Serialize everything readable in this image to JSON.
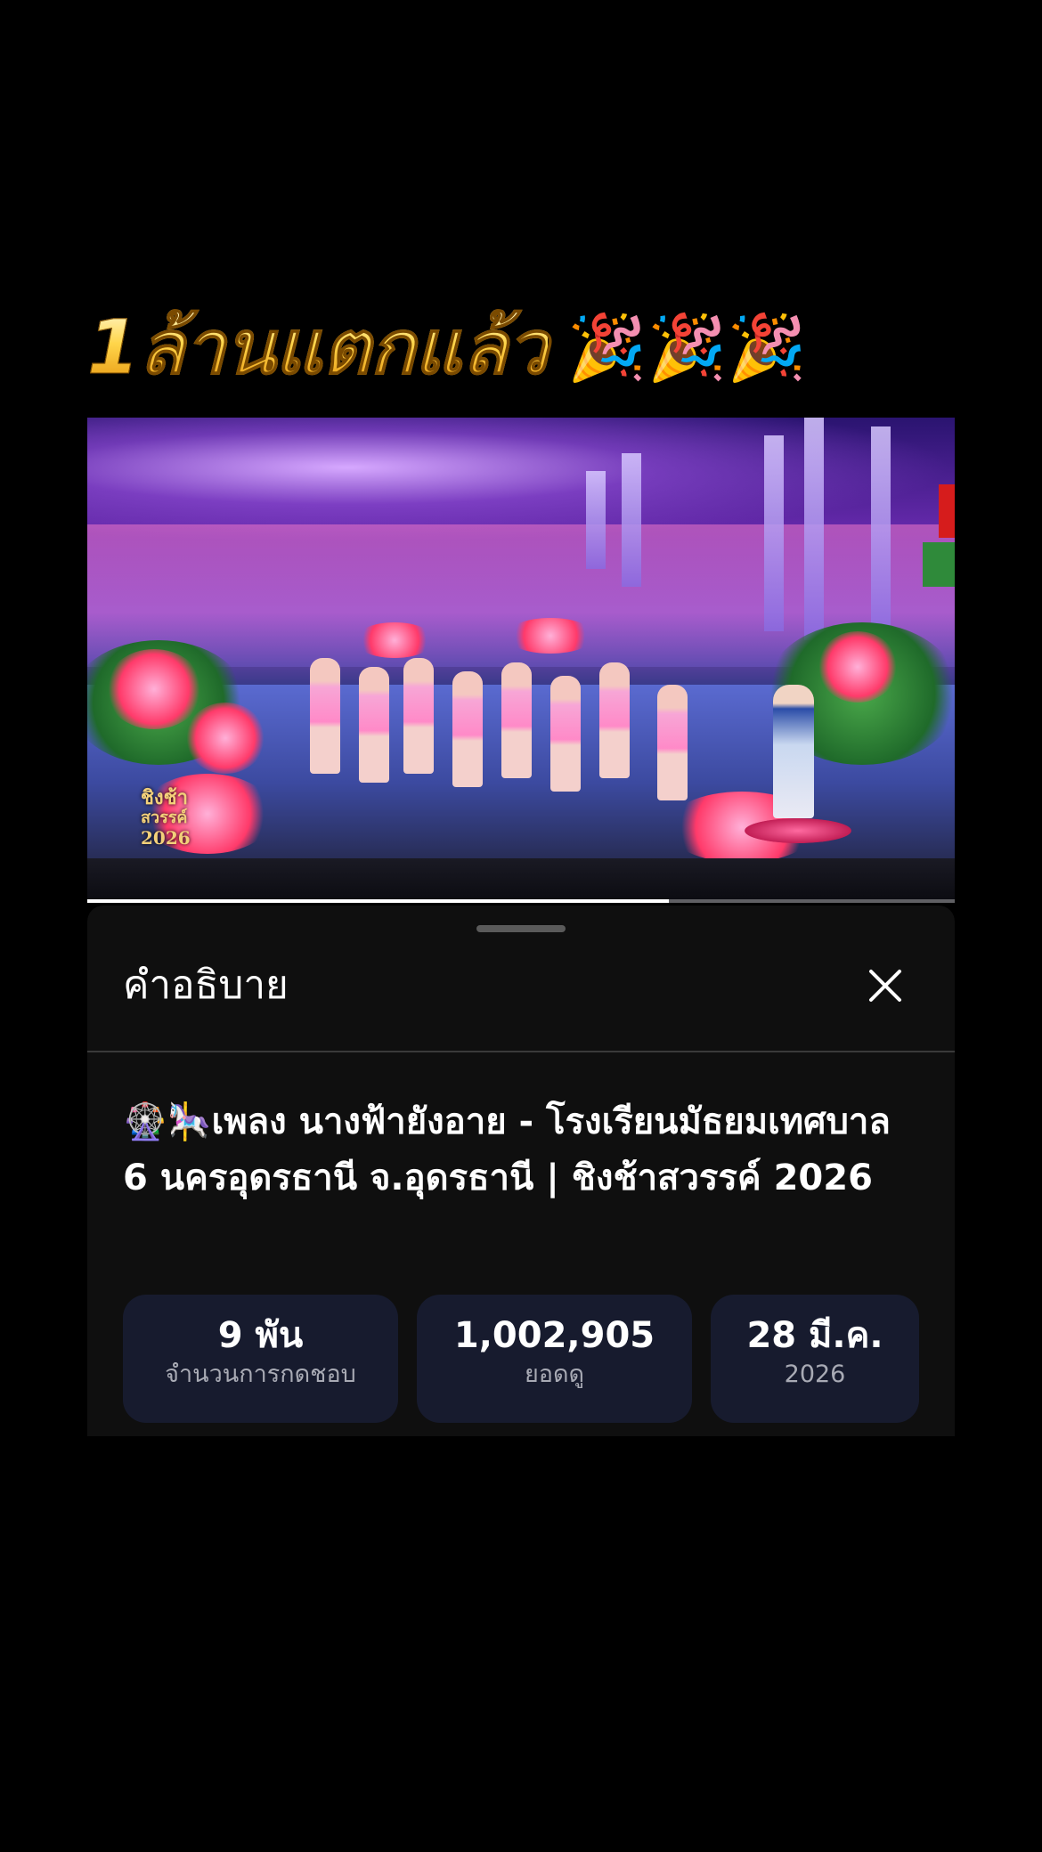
{
  "banner": {
    "text": "1ล้านแตกแล้ว",
    "emojis": "🎉🎉🎉"
  },
  "video": {
    "logo_line1": "ชิงช้า",
    "logo_line2": "สวรรค์",
    "logo_line3": "2026",
    "progress": 0.67
  },
  "sheet": {
    "title": "คำอธิบาย",
    "close_icon": "close-icon",
    "video_title": "🎡🎠เพลง นางฟ้ายังอาย - โรงเรียนมัธยมเทศบาล 6 นครอุดรธานี จ.อุดรธานี | ชิงช้าสวรรค์ 2026",
    "stats": [
      {
        "value": "9 พัน",
        "label": "จำนวนการกดชอบ"
      },
      {
        "value": "1,002,905",
        "label": "ยอดดู"
      },
      {
        "value": "28 มี.ค.",
        "label": "2026"
      }
    ]
  },
  "colors": {
    "sheet_bg": "#0f0f0f",
    "stat_bg": "#171b2e",
    "banner_gold": "#ffd54a"
  }
}
